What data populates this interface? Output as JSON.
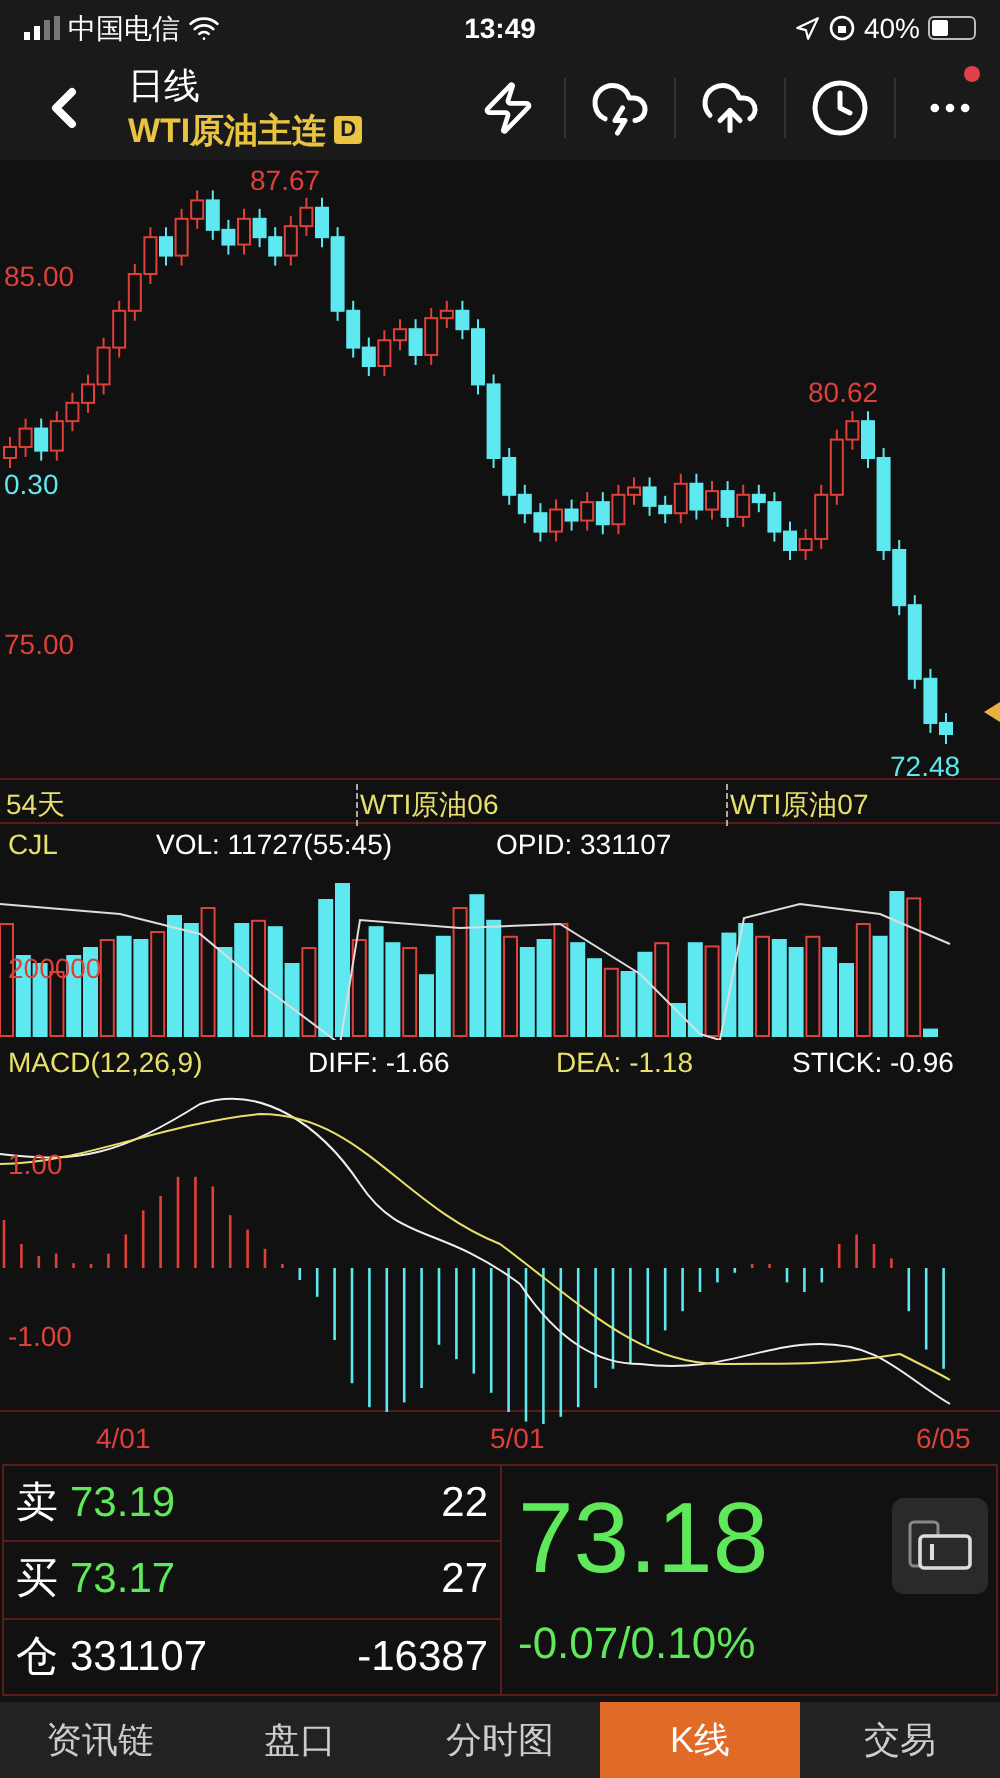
{
  "status_bar": {
    "carrier": "中国电信",
    "time": "13:49",
    "battery": "40%"
  },
  "header": {
    "title": "日线",
    "subtitle": "WTI原油主连",
    "badge": "D",
    "has_notification": true
  },
  "price_chart": {
    "high_label": "87.67",
    "axis_labels": [
      {
        "text": "85.00",
        "kind": "up"
      },
      {
        "text": "0.30",
        "kind": "down"
      },
      {
        "text": "75.00",
        "kind": "up"
      }
    ],
    "peak_label": "80.62",
    "low_label": "72.48"
  },
  "contracts": [
    {
      "text": "54天"
    },
    {
      "text": "WTI原油06"
    },
    {
      "text": "WTI原油07"
    }
  ],
  "volume": {
    "name": "CJL",
    "vol": "VOL: 11727(55:45)",
    "opid": "OPID: 331107",
    "axis_label": "200000"
  },
  "macd": {
    "name": "MACD(12,26,9)",
    "diff": "DIFF: -1.66",
    "dea": "DEA: -1.18",
    "stick": "STICK: -0.96",
    "axis_labels": [
      "1.00",
      "-1.00"
    ]
  },
  "dates": [
    "4/01",
    "5/01",
    "6/05"
  ],
  "quote": {
    "rows": [
      {
        "kind": "quote",
        "label": "卖",
        "price": "73.19",
        "qty": "22"
      },
      {
        "kind": "quote",
        "label": "买",
        "price": "73.17",
        "qty": "27"
      },
      {
        "kind": "position",
        "label": "仓",
        "price": "331107",
        "qty": "-16387"
      }
    ],
    "last": "73.18",
    "change": "-0.07/0.10%"
  },
  "tabs": [
    {
      "label": "资讯链",
      "selected": false
    },
    {
      "label": "盘口",
      "selected": false
    },
    {
      "label": "分时图",
      "selected": false
    },
    {
      "label": "K线",
      "selected": true
    },
    {
      "label": "交易",
      "selected": false
    }
  ]
}
